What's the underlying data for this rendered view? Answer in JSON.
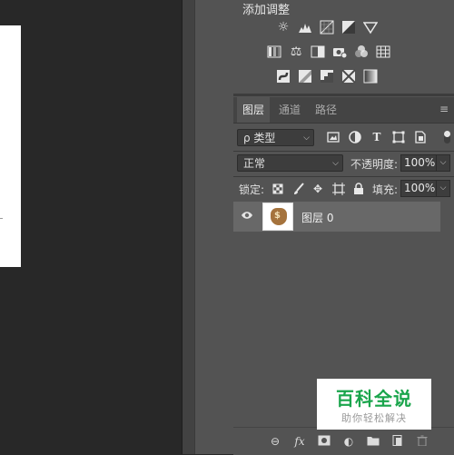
{
  "adjustments": {
    "title": "添加调整",
    "row1_icons": [
      "brightness-contrast-icon",
      "levels-icon",
      "curves-icon",
      "exposure-icon",
      "vibrance-icon"
    ],
    "row2_icons": [
      "hue-saturation-icon",
      "color-balance-icon",
      "black-white-icon",
      "photo-filter-icon",
      "channel-mixer-icon",
      "color-lookup-icon"
    ],
    "row3_icons": [
      "invert-icon",
      "posterize-icon",
      "threshold-icon",
      "selective-color-icon",
      "gradient-map-icon"
    ]
  },
  "tabs": [
    {
      "label": "图层",
      "active": true
    },
    {
      "label": "通道",
      "active": false
    },
    {
      "label": "路径",
      "active": false
    }
  ],
  "filter": {
    "kind_label": "ρ 类型",
    "icons": [
      "pixel-filter-icon",
      "adjustment-filter-icon",
      "type-filter-icon",
      "shape-filter-icon",
      "smart-object-filter-icon"
    ]
  },
  "blend": {
    "mode": "正常",
    "opacity_label": "不透明度:",
    "opacity_value": "100%"
  },
  "lock": {
    "label": "锁定:",
    "fill_label": "填充:",
    "fill_value": "100%"
  },
  "layers": [
    {
      "name": "图层 0",
      "visible": true
    }
  ],
  "footer_icons": [
    "link-layers-icon",
    "fx-icon",
    "layer-mask-icon",
    "adjustment-layer-icon",
    "group-icon",
    "new-layer-icon",
    "trash-icon"
  ],
  "watermark": {
    "title": "百科全说",
    "subtitle": "助你轻松解决"
  }
}
